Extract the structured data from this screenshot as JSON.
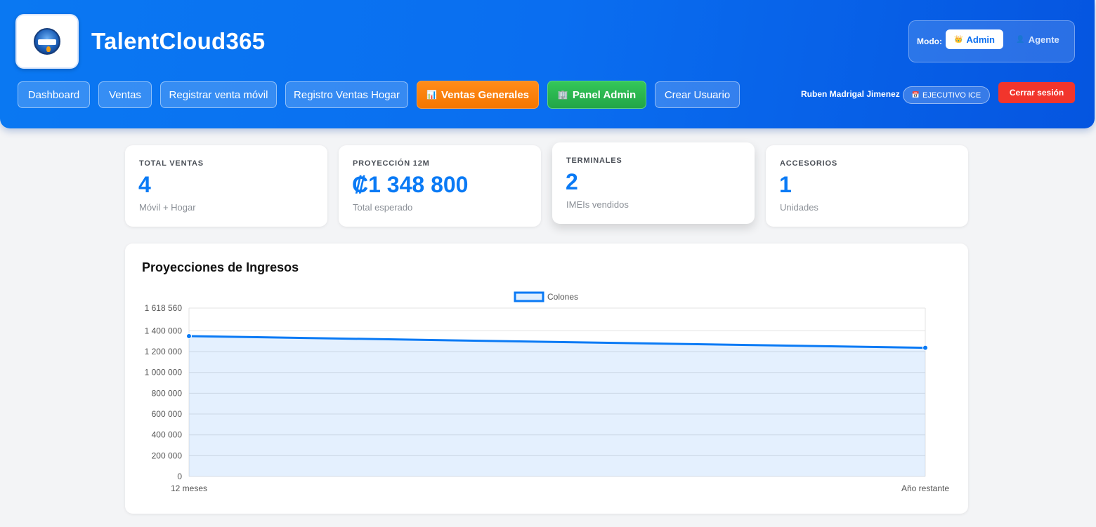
{
  "app": {
    "title": "TalentCloud365",
    "logo_text": "TalentCloud 365"
  },
  "nav": {
    "items": [
      {
        "label": "Dashboard"
      },
      {
        "label": "Ventas"
      },
      {
        "label": "Registrar venta móvil"
      },
      {
        "label": "Registro Ventas Hogar"
      },
      {
        "label": "Ventas Generales",
        "icon": "bar-chart-icon",
        "color": "#f57600"
      },
      {
        "label": "Panel Admin",
        "icon": "building-icon",
        "color": "#22a547"
      },
      {
        "label": "Crear Usuario"
      }
    ]
  },
  "mode": {
    "label": "Modo:",
    "options": [
      {
        "label": "Admin",
        "icon": "crown-icon",
        "selected": true
      },
      {
        "label": "Agente",
        "icon": "person-icon",
        "selected": false
      }
    ]
  },
  "user": {
    "name": "Ruben Madrigal Jimenez",
    "role": "EJECUTIVO ICE",
    "role_icon": "calendar-icon",
    "logout_label": "Cerrar sesión",
    "logout_color": "#f2352c"
  },
  "stats": [
    {
      "label": "TOTAL VENTAS",
      "value": "4",
      "sub": "Móvil + Hogar"
    },
    {
      "label": "PROYECCIÓN 12M",
      "value": "₡1 348 800",
      "sub": "Total esperado"
    },
    {
      "label": "TERMINALES",
      "value": "2",
      "sub": "IMEIs vendidos"
    },
    {
      "label": "ACCESORIOS",
      "value": "1",
      "sub": "Unidades"
    }
  ],
  "accent_color": "#0a7af5",
  "chart": {
    "title": "Proyecciones de Ingresos"
  },
  "chart_data": {
    "type": "area",
    "categories": [
      "12 meses",
      "Año restante"
    ],
    "series": [
      {
        "name": "Colones",
        "values": [
          1348800,
          1236400
        ],
        "color": "#0a7af5"
      }
    ],
    "ylim": [
      0,
      1618560
    ],
    "yticks": [
      {
        "value": 1618560,
        "label": "1 618 560"
      },
      {
        "value": 1400000,
        "label": "1 400 000"
      },
      {
        "value": 1200000,
        "label": "1 200 000"
      },
      {
        "value": 1000000,
        "label": "1 000 000"
      },
      {
        "value": 800000,
        "label": "800 000"
      },
      {
        "value": 600000,
        "label": "600 000"
      },
      {
        "value": 400000,
        "label": "400 000"
      },
      {
        "value": 200000,
        "label": "200 000"
      },
      {
        "value": 0,
        "label": "0"
      }
    ],
    "legend_position": "top-center",
    "grid": true
  }
}
